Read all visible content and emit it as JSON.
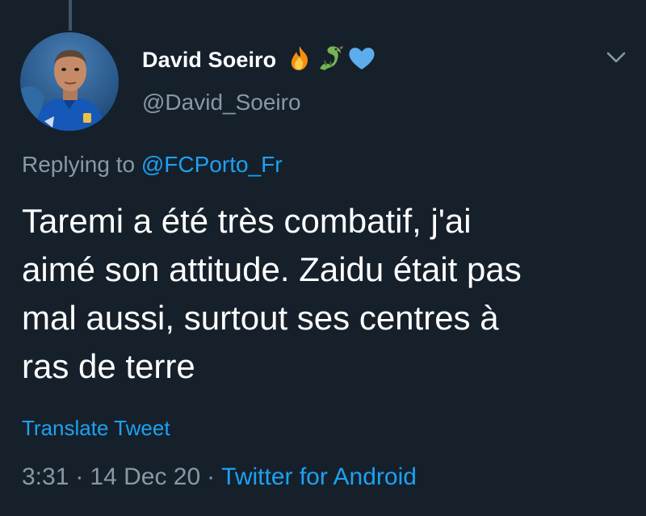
{
  "author": {
    "display_name": "David Soeiro",
    "handle": "@David_Soeiro",
    "emojis": [
      "fire-emoji",
      "dragon-emoji",
      "blue-heart-emoji"
    ]
  },
  "reply": {
    "prefix": "Replying to",
    "mention": "@FCPorto_Fr"
  },
  "tweet": {
    "lines": [
      "Taremi a été très combatif, j'ai",
      "aimé son attitude. Zaidu était pas",
      "mal aussi, surtout ses centres à",
      "ras de terre"
    ]
  },
  "translate_label": "Translate Tweet",
  "meta": {
    "time": "3:31",
    "date": "14 Dec 20",
    "source": "Twitter for Android",
    "separator": "·"
  },
  "colors": {
    "background": "#15202b",
    "secondary_text": "#8899a6",
    "accent": "#1da1f2",
    "primary_text": "#ffffff"
  }
}
